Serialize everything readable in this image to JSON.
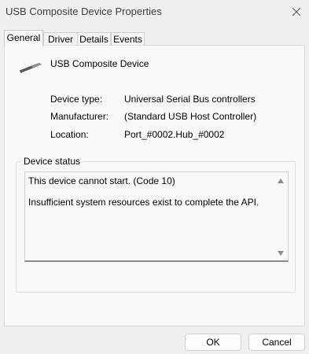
{
  "window": {
    "title": "USB Composite Device Properties",
    "close_icon": "close-icon"
  },
  "tabs": [
    {
      "label": "General",
      "active": true
    },
    {
      "label": "Driver",
      "active": false
    },
    {
      "label": "Details",
      "active": false
    },
    {
      "label": "Events",
      "active": false
    }
  ],
  "device": {
    "name": "USB Composite Device",
    "icon": "usb-plug-icon",
    "properties": [
      {
        "label": "Device type:",
        "value": "Universal Serial Bus controllers"
      },
      {
        "label": "Manufacturer:",
        "value": "(Standard USB Host Controller)"
      },
      {
        "label": "Location:",
        "value": "Port_#0002.Hub_#0002"
      }
    ]
  },
  "status": {
    "legend": "Device status",
    "line1": "This device cannot start. (Code 10)",
    "line2": "Insufficient system resources exist to complete the API."
  },
  "buttons": {
    "ok": "OK",
    "cancel": "Cancel"
  }
}
